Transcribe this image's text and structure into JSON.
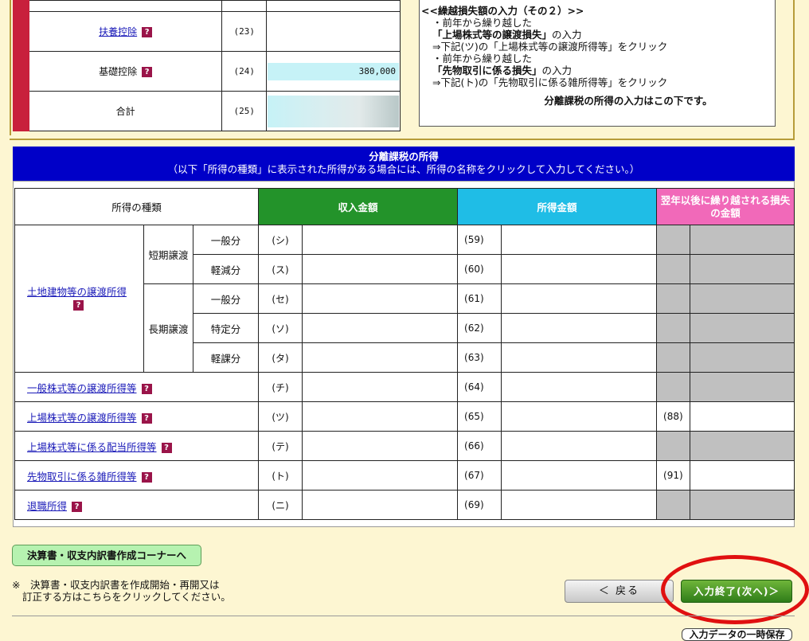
{
  "deduction_rows": [
    {
      "label": "",
      "num": "",
      "value": ""
    },
    {
      "label": "扶養控除",
      "num": "(23)",
      "value": "",
      "link": true,
      "help": "?"
    },
    {
      "label": "基礎控除",
      "num": "(24)",
      "value": "380,000",
      "help": "?"
    },
    {
      "label": "合計",
      "num": "(25)",
      "value": ""
    }
  ],
  "info_box": {
    "title": "<<繰越損失額の入力（その２）>>",
    "line1": "・前年から繰り越した",
    "line2_bold": "「上場株式等の譲渡損失」",
    "line2_rest": "の入力",
    "line3": "⇒下記(ツ)の「上場株式等の譲渡所得等」をクリック",
    "line4": "・前年から繰り越した",
    "line5_bold": "「先物取引に係る損失」",
    "line5_rest": "の入力",
    "line6": "⇒下記(ト)の「先物取引に係る雑所得等」をクリック",
    "footer": "分離課税の所得の入力はこの下です。"
  },
  "section": {
    "title": "分離課税の所得",
    "subtitle": "（以下「所得の種類」に表示された所得がある場合には、所得の名称をクリックして入力してください。）"
  },
  "table": {
    "headers": {
      "type": "所得の種類",
      "revenue": "収入金額",
      "income": "所得金額",
      "carryover": "翌年以後に繰り越される損失の金額"
    },
    "land": {
      "label": "土地建物等の譲渡所得",
      "short_term": "短期譲渡",
      "long_term": "長期譲渡"
    },
    "rows": [
      {
        "sub": "一般分",
        "code": "(シ)",
        "num": "(59)"
      },
      {
        "sub": "軽減分",
        "code": "(ス)",
        "num": "(60)"
      },
      {
        "sub": "一般分",
        "code": "(セ)",
        "num": "(61)"
      },
      {
        "sub": "特定分",
        "code": "(ソ)",
        "num": "(62)"
      },
      {
        "sub": "軽課分",
        "code": "(タ)",
        "num": "(63)"
      },
      {
        "label": "一般株式等の譲渡所得等",
        "code": "(チ)",
        "num": "(64)"
      },
      {
        "label": "上場株式等の譲渡所得等",
        "code": "(ツ)",
        "num": "(65)",
        "carry": "(88)"
      },
      {
        "label": "上場株式等に係る配当所得等",
        "code": "(テ)",
        "num": "(66)"
      },
      {
        "label": "先物取引に係る雑所得等",
        "code": "(ト)",
        "num": "(67)",
        "carry": "(91)"
      },
      {
        "label": "退職所得",
        "code": "(ニ)",
        "num": "(69)"
      }
    ]
  },
  "help_icon": "?",
  "buttons": {
    "corner": "決算書・収支内訳書作成コーナーへ",
    "back": "＜ 戻る",
    "next": "入力終了(次へ)＞",
    "save": "入力データの一時保存"
  },
  "note": {
    "line1": "※　決算書・収支内訳書を作成開始・再開又は",
    "line2": "訂正する方はこちらをクリックしてください。"
  },
  "colors": {
    "background": "#fdf6d2",
    "section_header": "#0000c8",
    "revenue_header": "#23932a",
    "income_header": "#1fbde6",
    "carryover_header": "#f169b9",
    "accent_red": "#c8203c",
    "highlight_ring": "#e01010"
  }
}
